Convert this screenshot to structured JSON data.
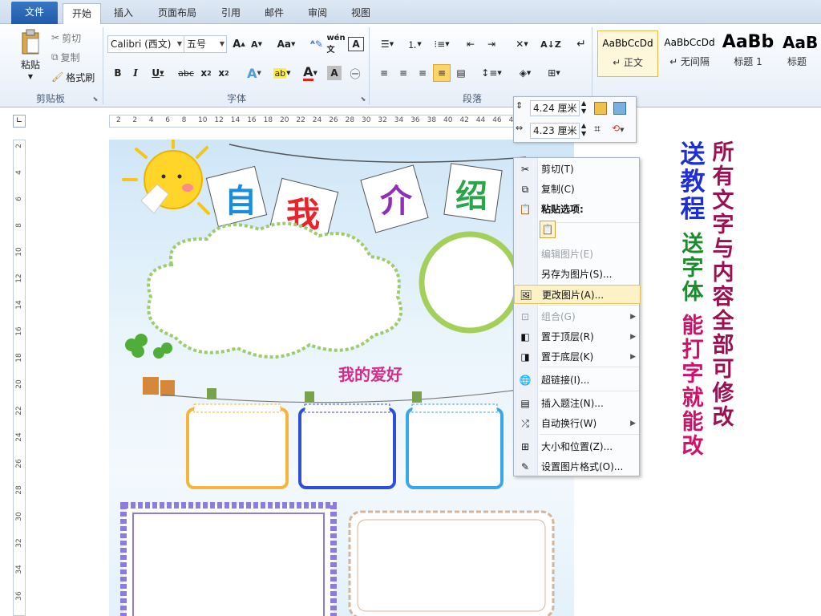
{
  "tabs": [
    "文件",
    "开始",
    "插入",
    "页面布局",
    "引用",
    "邮件",
    "审阅",
    "视图"
  ],
  "clipboard": {
    "paste": "粘贴",
    "cut": "剪切",
    "copy": "复制",
    "format_painter": "格式刷",
    "group": "剪贴板"
  },
  "font": {
    "name": "Calibri (西文)",
    "size": "五号",
    "group": "字体"
  },
  "paragraph": {
    "group": "段落"
  },
  "styles": [
    {
      "preview": "AaBbCcDd",
      "name": "↵ 正文"
    },
    {
      "preview": "AaBbCcDd",
      "name": "↵ 无间隔"
    },
    {
      "preview": "AaBb",
      "name": "标题 1"
    },
    {
      "preview": "AaB",
      "name": "标题"
    }
  ],
  "size_toolbar": {
    "height": "4.24 厘米",
    "width": "4.23 厘米"
  },
  "ruler_h": [
    "2",
    "2",
    "4",
    "6",
    "8",
    "10",
    "12",
    "14",
    "16",
    "18",
    "20",
    "22",
    "24",
    "26",
    "28",
    "30",
    "32",
    "34",
    "36",
    "38",
    "40",
    "42",
    "44",
    "46",
    "48"
  ],
  "ruler_v": [
    "2",
    "4",
    "6",
    "8",
    "10",
    "12",
    "14",
    "16",
    "18",
    "20",
    "22",
    "24",
    "26",
    "28",
    "30",
    "32",
    "34",
    "36"
  ],
  "page": {
    "title_chars": [
      "自",
      "我",
      "介",
      "绍"
    ],
    "hobby_title": "我的爱好",
    "colors": {
      "blue": "#1a8de0",
      "red": "#e8232c",
      "purple": "#8e2fb8",
      "green": "#2aa54a"
    }
  },
  "context_menu": [
    {
      "icon": "scissors-icon",
      "label": "剪切(T)",
      "disabled": false
    },
    {
      "icon": "copy-icon",
      "label": "复制(C)",
      "disabled": false
    },
    {
      "icon": "paste-icon",
      "label": "粘贴选项:",
      "disabled": false,
      "bold": true
    },
    {
      "icon": "edit-picture-icon",
      "label": "编辑图片(E)",
      "disabled": true
    },
    {
      "icon": "",
      "label": "另存为图片(S)...",
      "disabled": false
    },
    {
      "icon": "change-picture-icon",
      "label": "更改图片(A)...",
      "disabled": false,
      "highlight": true
    },
    {
      "icon": "group-icon",
      "label": "组合(G)",
      "disabled": true,
      "sub": true
    },
    {
      "icon": "bring-front-icon",
      "label": "置于顶层(R)",
      "disabled": false,
      "sub": true
    },
    {
      "icon": "send-back-icon",
      "label": "置于底层(K)",
      "disabled": false,
      "sub": true
    },
    {
      "icon": "hyperlink-icon",
      "label": "超链接(I)...",
      "disabled": false
    },
    {
      "icon": "caption-icon",
      "label": "插入题注(N)...",
      "disabled": false
    },
    {
      "icon": "wrap-text-icon",
      "label": "自动换行(W)",
      "disabled": false,
      "sub": true
    },
    {
      "icon": "size-position-icon",
      "label": "大小和位置(Z)...",
      "disabled": false
    },
    {
      "icon": "format-picture-icon",
      "label": "设置图片格式(O)...",
      "disabled": false
    }
  ],
  "promo": {
    "col1": "送教程",
    "col1b": "送字体",
    "col1c": "能打字就能改",
    "col2": "所有文字与内容全部可修改",
    "colors": {
      "blue": "#1f2fd6",
      "green": "#1e8a2e",
      "magenta": "#d0106a",
      "maroon": "#9a1050"
    }
  }
}
